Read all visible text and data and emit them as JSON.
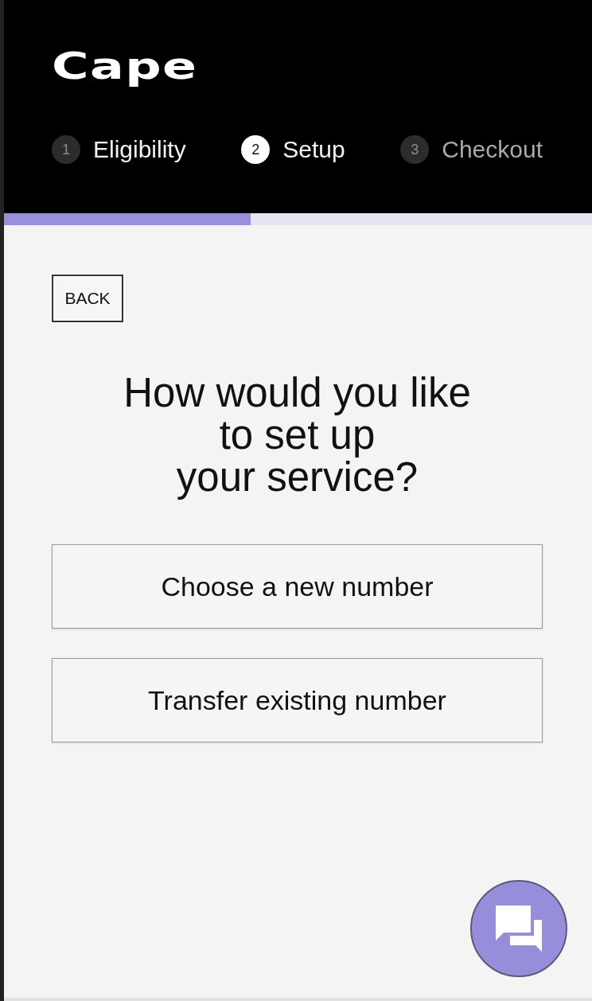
{
  "header": {
    "logo": "Cape",
    "steps": [
      {
        "number": "1",
        "label": "Eligibility",
        "selected": false
      },
      {
        "number": "2",
        "label": "Setup",
        "selected": true
      },
      {
        "number": "3",
        "label": "Checkout",
        "selected": false
      }
    ],
    "progress": {
      "level": 0.42
    }
  },
  "back_button": {
    "label": "BACK"
  },
  "question": "How would you like\nto set up\nyour service?",
  "options": [
    {
      "label": "Choose a new number"
    },
    {
      "label": "Transfer existing number"
    }
  ]
}
